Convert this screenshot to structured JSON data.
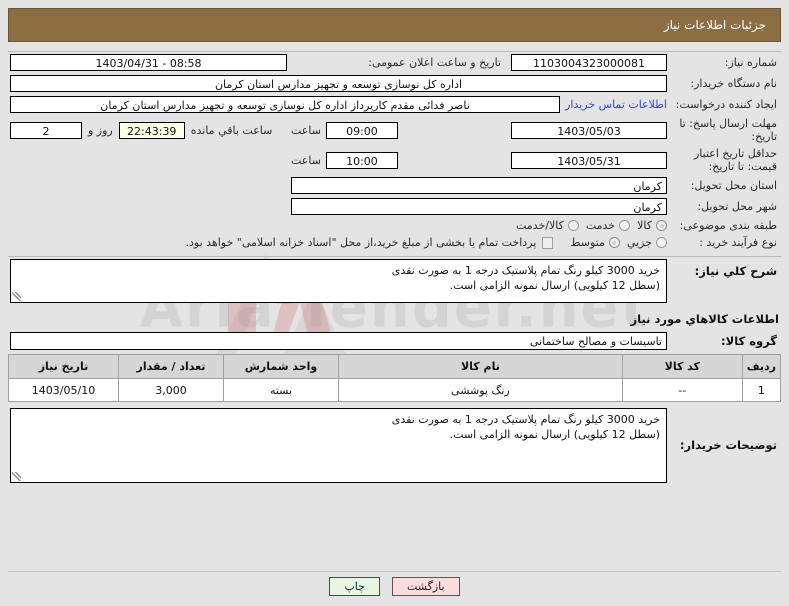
{
  "header": {
    "title": "جزئیات اطلاعات نیاز"
  },
  "watermark": {
    "text": "Aria Tender.net"
  },
  "form": {
    "need_number_label": "شماره نیاز:",
    "need_number_value": "1103004323000081",
    "announce_datetime_label": "تاریخ و ساعت اعلان عمومی:",
    "announce_datetime_value": "08:58 - 1403/04/31",
    "buyer_org_label": "نام دستگاه خریدار:",
    "buyer_org_value": "اداره کل نوسازی  توسعه و تجهیز مدارس استان کرمان",
    "requester_label": "ایجاد کننده درخواست:",
    "requester_value": "ناصر فدائی مقدم کارپرداز اداره کل نوسازی  توسعه و تجهیز مدارس استان کرمان",
    "contact_link": "اطلاعات تماس خریدار",
    "reply_deadline_label": "مهلت ارسال پاسخ: تا تاریخ:",
    "reply_deadline_date": "1403/05/03",
    "hour_label": "ساعت",
    "reply_deadline_time": "09:00",
    "remaining_days": "2",
    "remaining_days_label": "روز و",
    "remaining_time": "22:43:39",
    "remaining_suffix_label": "ساعت باقي مانده",
    "price_validity_label": "حداقل تاریخ اعتبار قیمت: تا تاریخ:",
    "price_validity_date": "1403/05/31",
    "price_validity_time": "10:00",
    "delivery_province_label": "استان محل تحویل:",
    "delivery_province_value": "کرمان",
    "delivery_city_label": "شهر محل تحویل:",
    "delivery_city_value": "کرمان",
    "category_label": "طبقه بندی موضوعی:",
    "category_options": [
      {
        "label": "کالا",
        "selected": true
      },
      {
        "label": "خدمت",
        "selected": false
      },
      {
        "label": "کالا/خدمت",
        "selected": false
      }
    ],
    "process_type_label": "نوع فرآیند خرید :",
    "process_options": [
      {
        "label": "جزیي",
        "selected": false
      },
      {
        "label": "متوسط",
        "selected": true
      }
    ],
    "treasury_checkbox_text": "پرداخت تمام یا بخشی از مبلغ خرید،از محل \"اسناد خزانه اسلامی\" خواهد بود.",
    "treasury_checked": false
  },
  "summary": {
    "label": "شرح کلي نیاز:",
    "text": "خرید 3000 کیلو رنگ تمام پلاستیک درجه 1 به صورت نقدی\n(سطل 12 کیلویی) ارسال نمونه الزامی است."
  },
  "goods_section": {
    "title": "اطلاعات کالاهاي مورد نیاز",
    "group_label": "گروه کالا:",
    "group_value": "تاسیسات و مصالح ساختمانی"
  },
  "items_table": {
    "columns": [
      "ردیف",
      "کد کالا",
      "نام کالا",
      "واحد شمارش",
      "تعداد / مقدار",
      "تاریخ نیاز"
    ],
    "rows": [
      {
        "row": "1",
        "code": "--",
        "name": "رنگ پوششی",
        "unit": "بسته",
        "quantity": "3,000",
        "need_date": "1403/05/10"
      }
    ]
  },
  "buyer_notes": {
    "label": "توضیحات خریدار:",
    "text": "خرید 3000 کیلو رنگ تمام پلاستیک درجه 1 به صورت نقدی\n(سطل 12 کیلویی) ارسال نمونه الزامی است."
  },
  "footer": {
    "back_label": "بازگشت",
    "print_label": "چاپ"
  }
}
